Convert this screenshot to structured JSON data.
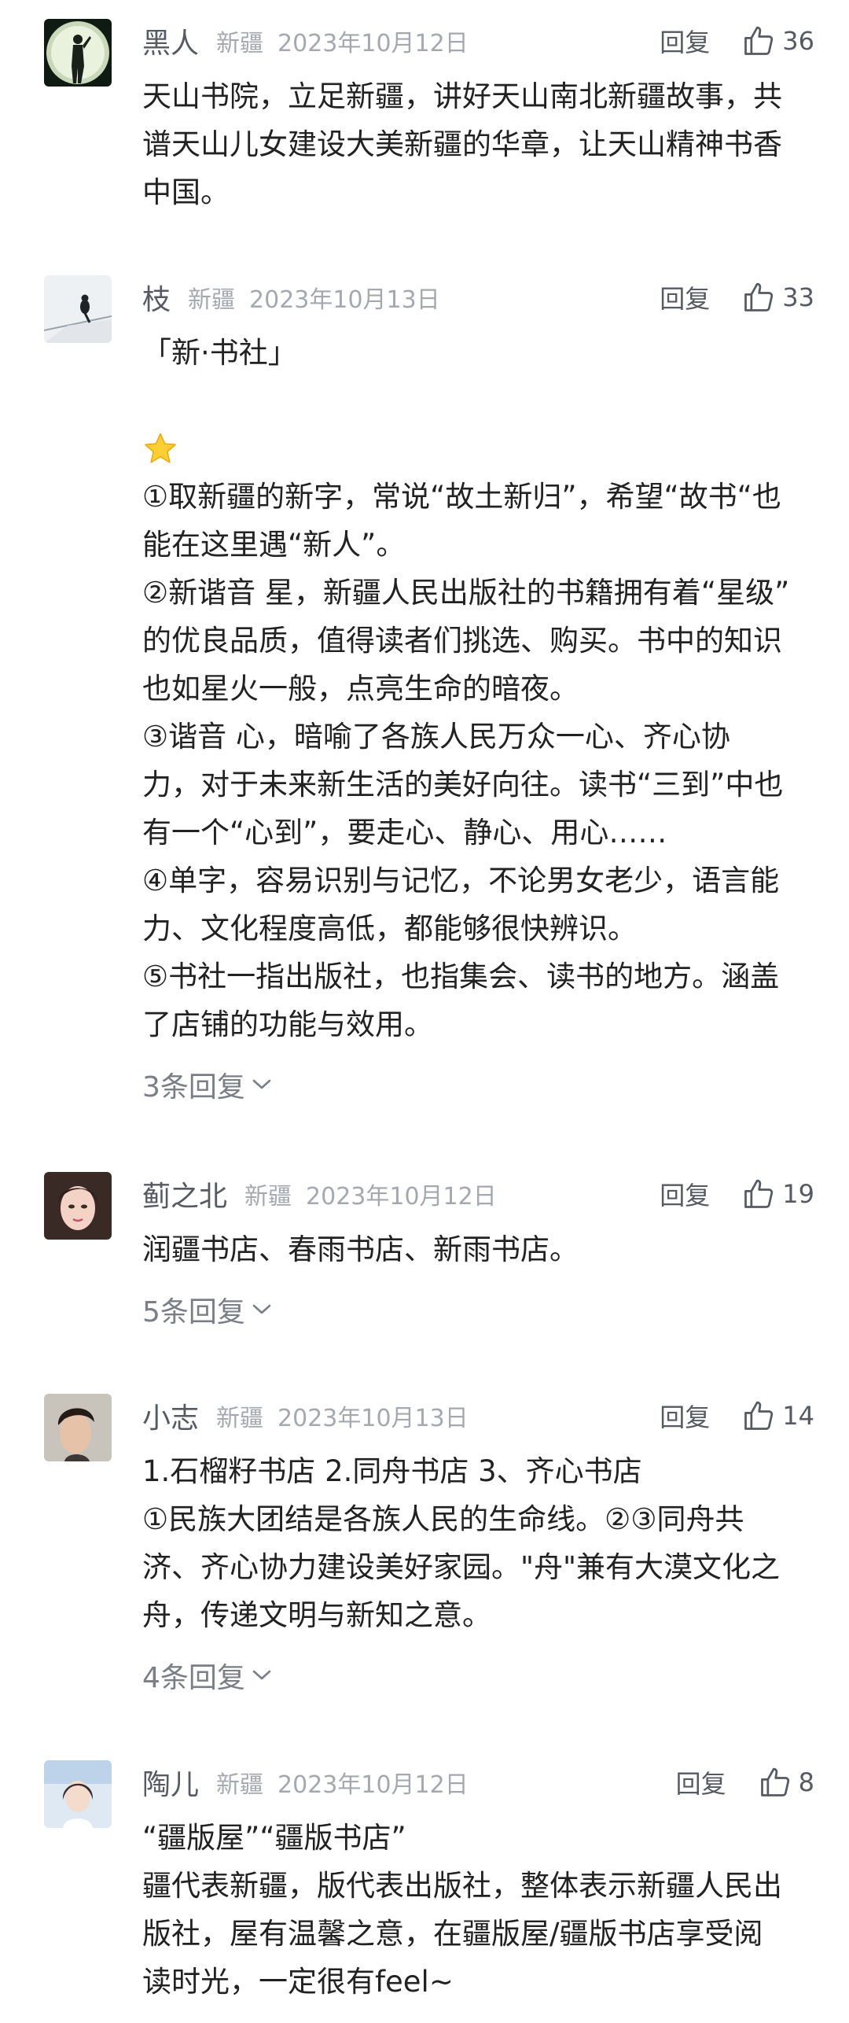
{
  "comments": [
    {
      "username": "黑人",
      "location": "新疆",
      "date": "2023年10月12日",
      "reply_label": "回复",
      "likes": "36",
      "avatar": "silhouette-avatar",
      "lines": [
        "天山书院，立足新疆，讲好天山南北新疆故事，共",
        "谱天山儿女建设大美新疆的华章，让天山精神书香",
        "中国。"
      ]
    },
    {
      "username": "枝",
      "location": "新疆",
      "date": "2023年10月13日",
      "reply_label": "回复",
      "likes": "33",
      "avatar": "bird-on-branch-avatar",
      "lines": [
        "「新·书社」",
        "",
        "⭐",
        "①取新疆的新字，常说“故土新归”，希望“故书“也",
        "能在这里遇“新人”。",
        "②新谐音 星，新疆人民出版社的书籍拥有着“星级”",
        "的优良品质，值得读者们挑选、购买。书中的知识",
        "也如星火一般，点亮生命的暗夜。",
        "③谐音 心，暗喻了各族人民万众一心、齐心协",
        "力，对于未来新生活的美好向往。读书“三到”中也",
        "有一个“心到”，要走心、静心、用心……",
        "④单字，容易识别与记忆，不论男女老少，语言能",
        "力、文化程度高低，都能够很快辨识。",
        "⑤书社一指出版社，也指集会、读书的地方。涵盖",
        "了店铺的功能与效用。"
      ],
      "replies_label": "3条回复"
    },
    {
      "username": "蓟之北",
      "location": "新疆",
      "date": "2023年10月12日",
      "reply_label": "回复",
      "likes": "19",
      "avatar": "woman-portrait-avatar",
      "lines": [
        "润疆书店、春雨书店、新雨书店。"
      ],
      "replies_label": "5条回复"
    },
    {
      "username": "小志",
      "location": "新疆",
      "date": "2023年10月13日",
      "reply_label": "回复",
      "likes": "14",
      "avatar": "man-portrait-avatar",
      "lines": [
        "1.石榴籽书店 2.同舟书店 3、齐心书店",
        "①民族大团结是各族人民的生命线。②③同舟共",
        "济、齐心协力建设美好家园。\"舟\"兼有大漠文化之",
        "舟，传递文明与新知之意。"
      ],
      "replies_label": "4条回复"
    },
    {
      "username": "陶儿",
      "location": "新疆",
      "date": "2023年10月12日",
      "reply_label": "回复",
      "likes": "8",
      "avatar": "girl-portrait-avatar",
      "lines": [
        "“疆版屋”“疆版书店”",
        "疆代表新疆，版代表出版社，整体表示新疆人民出",
        "版社，屋有温馨之意，在疆版屋/疆版书店享受阅",
        "读时光，一定很有feel~"
      ]
    }
  ],
  "colors": {
    "username": "#555a63",
    "meta": "#a4a9b0",
    "body_text": "#222222",
    "replies_link": "#7a7f87",
    "background": "#ffffff"
  }
}
